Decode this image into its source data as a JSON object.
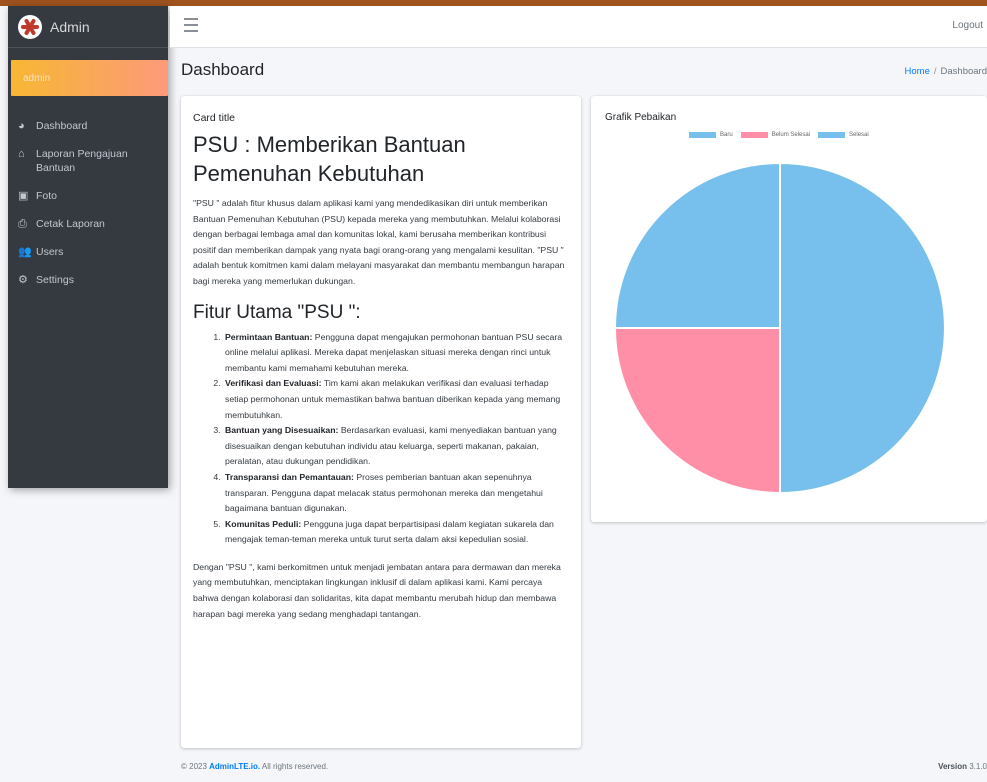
{
  "brand": {
    "name": "Admin"
  },
  "user_panel": {
    "name": "admin"
  },
  "sidebar": {
    "items": [
      {
        "icon": "tachometer-icon",
        "glyph": "◕",
        "label": "Dashboard"
      },
      {
        "icon": "home-icon",
        "glyph": "⌂",
        "label": "Laporan Pengajuan Bantuan"
      },
      {
        "icon": "image-icon",
        "glyph": "▣",
        "label": "Foto"
      },
      {
        "icon": "print-icon",
        "glyph": "⎙",
        "label": "Cetak Laporan"
      },
      {
        "icon": "users-icon",
        "glyph": "👥",
        "label": "Users"
      },
      {
        "icon": "gear-icon",
        "glyph": "⚙",
        "label": "Settings"
      }
    ]
  },
  "header": {
    "logout": "Logout"
  },
  "page": {
    "title": "Dashboard",
    "breadcrumb": {
      "home": "Home",
      "separator": "/",
      "current": "Dashboard"
    }
  },
  "info_card": {
    "card_title": "Card title",
    "heading": "PSU : Memberikan Bantuan Pemenuhan Kebutuhan",
    "intro": "\"PSU \" adalah fitur khusus dalam aplikasi kami yang mendedikasikan diri untuk memberikan Bantuan Pemenuhan Kebutuhan (PSU) kepada mereka yang membutuhkan. Melalui kolaborasi dengan berbagai lembaga amal dan komunitas lokal, kami berusaha memberikan kontribusi positif dan memberikan dampak yang nyata bagi orang-orang yang mengalami kesulitan. \"PSU \" adalah bentuk komitmen kami dalam melayani masyarakat dan membantu membangun harapan bagi mereka yang memerlukan dukungan.",
    "features_heading": "Fitur Utama \"PSU \":",
    "features": [
      {
        "title": "Permintaan Bantuan:",
        "text": " Pengguna dapat mengajukan permohonan bantuan PSU secara online melalui aplikasi. Mereka dapat menjelaskan situasi mereka dengan rinci untuk membantu kami memahami kebutuhan mereka."
      },
      {
        "title": "Verifikasi dan Evaluasi:",
        "text": " Tim kami akan melakukan verifikasi dan evaluasi terhadap setiap permohonan untuk memastikan bahwa bantuan diberikan kepada yang memang membutuhkan."
      },
      {
        "title": "Bantuan yang Disesuaikan:",
        "text": " Berdasarkan evaluasi, kami menyediakan bantuan yang disesuaikan dengan kebutuhan individu atau keluarga, seperti makanan, pakaian, peralatan, atau dukungan pendidikan."
      },
      {
        "title": "Transparansi dan Pemantauan:",
        "text": " Proses pemberian bantuan akan sepenuhnya transparan. Pengguna dapat melacak status permohonan mereka dan mengetahui bagaimana bantuan digunakan."
      },
      {
        "title": "Komunitas Peduli:",
        "text": " Pengguna juga dapat berpartisipasi dalam kegiatan sukarela dan mengajak teman-teman mereka untuk turut serta dalam aksi kepedulian sosial."
      }
    ],
    "closing": "Dengan \"PSU \", kami berkomitmen untuk menjadi jembatan antara para dermawan dan mereka yang membutuhkan, menciptakan lingkungan inklusif di dalam aplikasi kami. Kami percaya bahwa dengan kolaborasi dan solidaritas, kita dapat membantu merubah hidup dan membawa harapan bagi mereka yang sedang menghadapi tantangan."
  },
  "chart_card": {
    "title": "Grafik Pebaikan"
  },
  "chart_data": {
    "type": "pie",
    "title": "Grafik Pebaikan",
    "categories": [
      "Baru",
      "Belum Selesai",
      "Selesai"
    ],
    "values": [
      1,
      1,
      2
    ],
    "colors": [
      "#77bfec",
      "#ff8fa7",
      "#77bfec"
    ],
    "legend_position": "top"
  },
  "footer": {
    "copyright_prefix": "© 2023 ",
    "brand": "AdminLTE.io.",
    "suffix": " All rights reserved.",
    "version_label": "Version",
    "version": " 3.1.0"
  }
}
